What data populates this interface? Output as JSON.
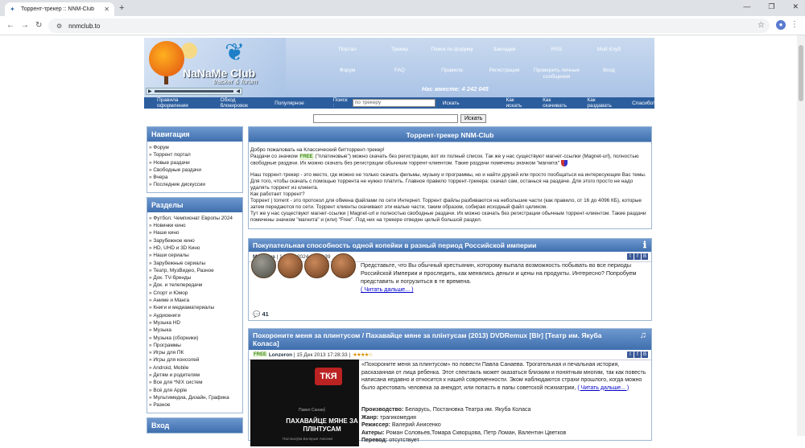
{
  "browser": {
    "tab_title": "Торрент-трекер :: NNM-Club",
    "url": "nnmclub.to"
  },
  "header": {
    "logo_title": "NaNaMe Club",
    "logo_subtitle": "tracker & forum",
    "menu": [
      "Портал",
      "Трекер",
      "Поиск по форуму",
      "Закладки",
      "RSS",
      "Мой Клуб",
      "Форум",
      "FAQ",
      "Правила",
      "Регистрация",
      "Проверить личные сообщения",
      "Вход"
    ],
    "online": "Нас вместе: 4 242 045"
  },
  "subnav": {
    "links_left": [
      "Правила оформления",
      "Обход блокировок",
      "Популярное"
    ],
    "search_label": "Поиск :",
    "search_placeholder": "по трекеру",
    "search_button": "Искать",
    "links_right": [
      "Как искать",
      "Как скачивать",
      "Как раздавать",
      "Спасибо!"
    ]
  },
  "global_search": {
    "button": "Искать"
  },
  "sidebar": {
    "nav_title": "Навигация",
    "nav_items": [
      "Форум",
      "Торрент портал",
      "Новые раздачи",
      "Свободные раздачи",
      "Вчера",
      "Последние дискуссии"
    ],
    "sections_title": "Разделы",
    "sections_items": [
      "Футбол. Чемпионат Европы 2024",
      "Новинки кино",
      "Наше кино",
      "Зарубежное кино",
      "HD, UHD и 3D Кино",
      "Наши сериалы",
      "Зарубежные сериалы",
      "Театр, МузВидео, Разное",
      "Док. TV-бренды",
      "Док. и телепередачи",
      "Спорт и Юмор",
      "Аниме и Манга",
      "Книги и медиаматериалы",
      "Аудиокниги",
      "Музыка HD",
      "Музыка",
      "Музыка (сборники)",
      "Программы",
      "Игры для ПК",
      "Игры для консолей",
      "Android, Mobile",
      "Детям и родителям",
      "Все для *NIX систем",
      "Всё для Apple",
      "Мультимедиа, Дизайн, Графика",
      "Разное"
    ],
    "login_title": "Вход"
  },
  "main": {
    "title": "Торрент-трекер NNM-Club",
    "welcome_l1": "Добро пожаловать на Классический битторрент-трекер!",
    "welcome_l2a": "Раздачи со значком",
    "free_badge": "FREE",
    "welcome_l2b": "(\"платиновые\") можно скачать без регистрации, вот их полный список. Так же у нас существуют магнет-ссылки (Magnet-url), полностью свободные раздачи. Их можно скачать без регистрации обычным торрент-клиентом. Такие раздачи помечены значком \"магнита\"",
    "welcome_l3": "Наш торрент-трекер - это место, где можно не только скачать фильмы, музыку и программы, но и найти друзей или просто пообщаться на интересующие Вас темы. Для того, чтобы скачать с помощью торрента не нужно платить. Главное правило торрент-трекера: скачал сам, останься на раздаче. Для этого просто не надо удалять торрент из клиента.",
    "welcome_l4": "Как работает торрент?",
    "welcome_l5": "Торрент | torrent - это протокол для обмена файлами по сети Интернет. Торрент файлы разбиваются на небольшие части (как правило, от 16 до 4096 КБ), которые затем передаются по сети. Торрент клиенты скачивают эти малые части, таким образом, собирая исходный файл целиком.",
    "welcome_l6": "Тут же у нас существуют магнет-ссылки | Magnet-url и полностью свободные раздачи. Их можно скачать без регистрации обычным торрент-клиентом. Такие раздачи помечены значком \"магнита\" и (или) \"Free\". Под них на трекере отведен целый большой раздел."
  },
  "news1": {
    "title": "Покупательная способность одной копейки в разный период Российской империи",
    "author": "Maximus",
    "date": "14 Окт 2024 22:25:39",
    "text": "Представьте, что Вы обычный крестьянин, которому выпала возможность побывать во все периоды Российской Империи и проследить, как менялись деньги и цены на продукты. Интересно? Попробуем представить и погрузиться в те времена.",
    "more": "( Читать дальше... )",
    "comments": "41"
  },
  "news2": {
    "title": "Похороните меня за плинтусом / Пахавайце мяне за плінтусам (2013) DVDRemux [Blr] [Театр им. Якуба Коласа]",
    "free": "FREE",
    "author": "Lonzeron",
    "date": "15 Дек 2013 17:28:33",
    "stars": "★★★★☆",
    "desc": "«Похороните меня за плинтусом» по повести Павла Санаева. Трогательная и печальная история, расказанная от лица ребенка. Этот спектакль может оказаться близким и понятным многим, так как повесть написана недавно и относится к нашей современности. Эком наблюдаются страхи прошлого, когда можно было арестовать человека за анекдот, или попасть в папы советской психиатрии,",
    "more": "( Читать дальше... )",
    "prod_label": "Производство:",
    "prod": "Беларусь, Постановка Театра им. Якуба Коласа",
    "genre_label": "Жанр:",
    "genre": "трагикомедия",
    "dir_label": "Режиссер:",
    "dir": "Валерий Анисенко",
    "actors_label": "Актеры:",
    "actors": "Роман Соловьев,Томара Скворцова, Петр Ломан, Валентин Цветков",
    "trans_label": "Перевод:",
    "trans": "отсутствует",
    "poster_badge": "ТКЯ",
    "poster_author": "Павел Санаеў",
    "poster_title": "ПАХАВАЙЦЕ МЯНЕ ЗА ПЛІНТУСАМ",
    "poster_credit": "Пастаноўка Валерыя Анісенкі"
  }
}
